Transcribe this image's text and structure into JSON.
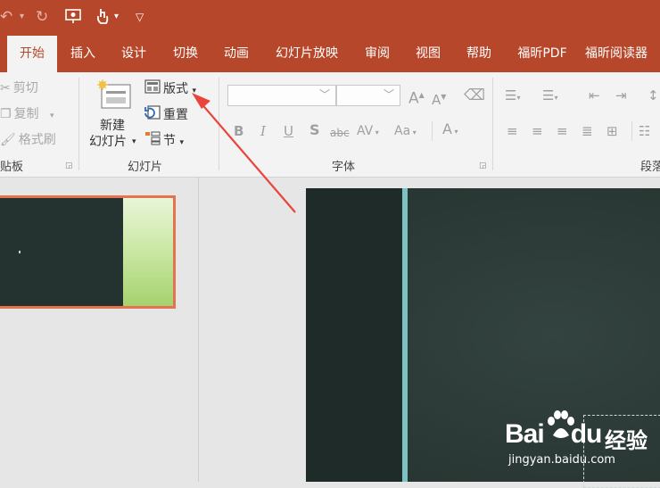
{
  "colors": {
    "accent": "#b7472a",
    "selection_border": "#e6734f",
    "slide_dark": "#2a3835",
    "slide_bar": "#7ec1c3",
    "annotation_arrow": "#e8453c"
  },
  "qat": {
    "icons": [
      "undo-icon",
      "redo-icon",
      "slideshow-icon",
      "touch-mode-icon",
      "customize-icon"
    ]
  },
  "tabs": [
    "开始",
    "插入",
    "设计",
    "切换",
    "动画",
    "幻灯片放映",
    "审阅",
    "视图",
    "帮助",
    "福昕PDF",
    "福昕阅读器"
  ],
  "active_tab": "开始",
  "clipboard": {
    "cut": "剪切",
    "copy": "复制",
    "format_painter": "格式刷",
    "group_label": "贴板"
  },
  "slides_group": {
    "new_slide_line1": "新建",
    "new_slide_line2": "幻灯片",
    "layout": "版式",
    "reset": "重置",
    "section": "节",
    "group_label": "幻灯片"
  },
  "font_group": {
    "font_name": "",
    "font_size": "",
    "grow": "A",
    "shrink": "A",
    "bold": "B",
    "italic": "I",
    "underline": "U",
    "shadow": "S",
    "strike": "abc",
    "spacing": "AV",
    "change_case": "Aa",
    "font_color": "A",
    "group_label": "字体"
  },
  "paragraph_group": {
    "group_label": "段落"
  },
  "watermark": {
    "brand": "Bai",
    "brand_suffix": "du",
    "cn": "经验",
    "url": "jingyan.baidu.com"
  }
}
